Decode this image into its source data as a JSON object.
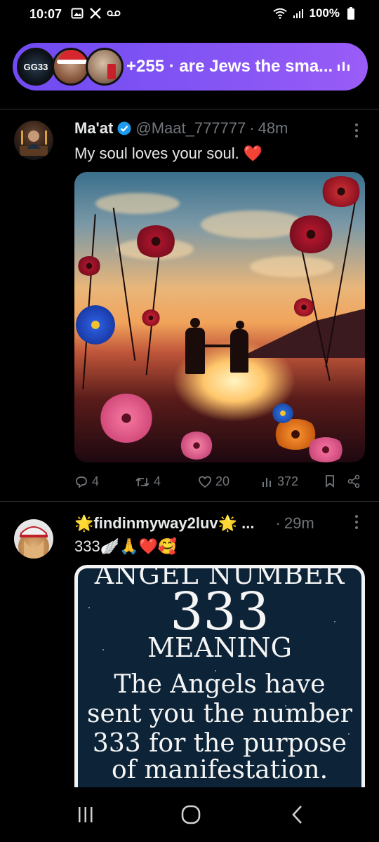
{
  "status_bar": {
    "time": "10:07",
    "battery": "100%",
    "icons_left": [
      "gallery-icon",
      "x-logo-icon",
      "voicemail-icon"
    ],
    "icons_right": [
      "wifi-icon",
      "signal-icon",
      "battery-icon"
    ]
  },
  "spaces": {
    "text": "+255 · are Jews the sma...",
    "host_badge": "GG33",
    "accent": "#7a4ff5"
  },
  "tweets": [
    {
      "name": "Ma'at",
      "handle": "@Maat_777777",
      "separator": "·",
      "time": "48m",
      "text": "My soul loves your soul. ❤️",
      "verified": true,
      "actions": {
        "replies": "4",
        "reposts": "4",
        "likes": "20",
        "views": "372"
      }
    },
    {
      "name": "🌟findinmyway2luv🌟 ...",
      "separator": "·",
      "time": "29m",
      "text": "333🪽🙏❤️🥰",
      "media_text": {
        "line1": "ANGEL NUMBER",
        "line2": "333",
        "line3": "MEANING",
        "line4": "The Angels have",
        "line5": "sent you the number",
        "line6": "333 for the purpose",
        "line7": "of manifestation."
      }
    }
  ],
  "nav": [
    "recents-icon",
    "home-icon",
    "back-icon"
  ]
}
